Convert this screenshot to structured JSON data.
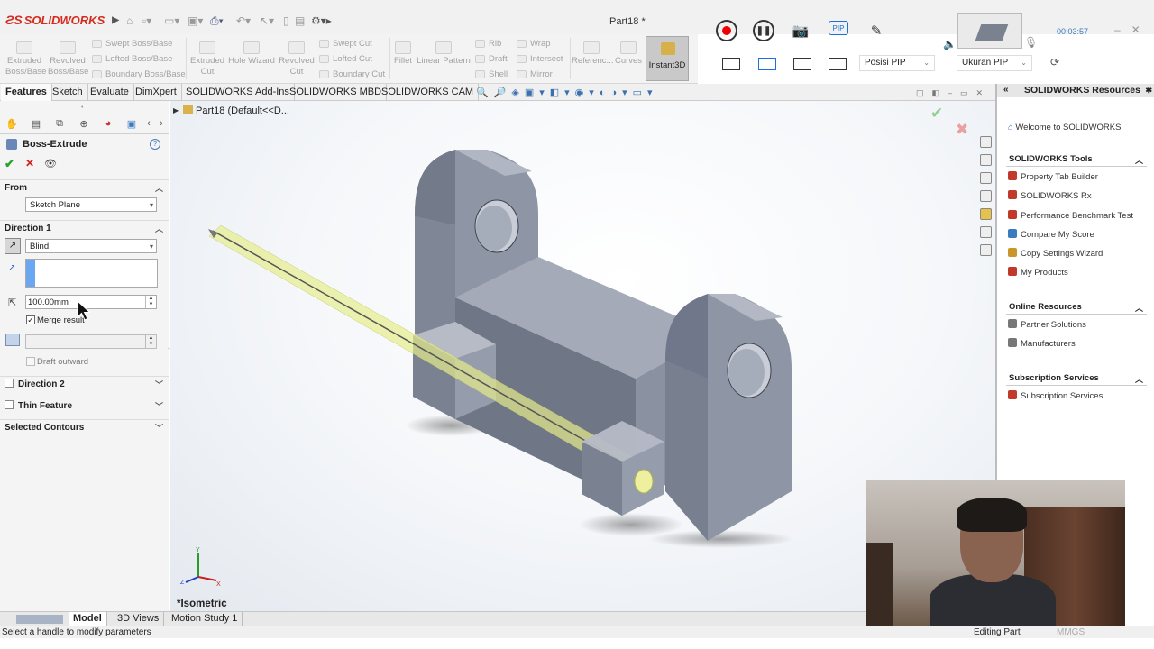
{
  "app": {
    "brand": "SOLIDWORKS",
    "doc_title": "Part18 *"
  },
  "recorder": {
    "timer": "00:03:57",
    "posisi_label": "Posisi PIP",
    "ukuran_label": "Ukuran PIP",
    "pip_label": "PIP"
  },
  "commands": {
    "extruded_boss": "Extruded Boss/Base",
    "revolved_boss": "Revolved Boss/Base",
    "swept_boss": "Swept Boss/Base",
    "lofted_boss": "Lofted Boss/Base",
    "boundary_boss": "Boundary Boss/Base",
    "extruded_cut": "Extruded Cut",
    "hole_wizard": "Hole Wizard",
    "revolved_cut": "Revolved Cut",
    "swept_cut": "Swept Cut",
    "lofted_cut": "Lofted Cut",
    "boundary_cut": "Boundary Cut",
    "fillet": "Fillet",
    "linear_pattern": "Linear Pattern",
    "rib": "Rib",
    "draft": "Draft",
    "shell": "Shell",
    "wrap": "Wrap",
    "intersect": "Intersect",
    "mirror": "Mirror",
    "reference": "Referenc...",
    "curves": "Curves",
    "instant3d": "Instant3D"
  },
  "tabs": [
    "Features",
    "Sketch",
    "Evaluate",
    "DimXpert",
    "SOLIDWORKS Add-Ins",
    "SOLIDWORKS MBD",
    "SOLIDWORKS CAM"
  ],
  "property_manager": {
    "title": "Boss-Extrude",
    "from_label": "From",
    "from_value": "Sketch Plane",
    "direction1_label": "Direction 1",
    "end_condition": "Blind",
    "depth": "100.00mm",
    "merge_result": "Merge result",
    "draft_outward": "Draft outward",
    "direction2_label": "Direction 2",
    "thin_feature_label": "Thin Feature",
    "selected_contours_label": "Selected Contours"
  },
  "viewport": {
    "tree_item": "Part18  (Default<<D...",
    "view_name": "*Isometric",
    "triad": {
      "x": "X",
      "y": "Y",
      "z": "Z"
    }
  },
  "bottom_tabs": [
    "Model",
    "3D Views",
    "Motion Study 1"
  ],
  "status": {
    "message": "Select a handle to modify parameters",
    "mode": "Editing Part",
    "units": "MMGS"
  },
  "task_pane": {
    "title": "SOLIDWORKS Resources",
    "welcome": "Welcome to SOLIDWORKS",
    "tools_header": "SOLIDWORKS Tools",
    "tools": [
      "Property Tab Builder",
      "SOLIDWORKS Rx",
      "Performance Benchmark Test",
      "Compare My Score",
      "Copy Settings Wizard",
      "My Products"
    ],
    "online_header": "Online Resources",
    "online": [
      "Partner Solutions",
      "Manufacturers"
    ],
    "subscription_header": "Subscription Services",
    "subscription": [
      "Subscription Services"
    ]
  },
  "colors": {
    "brand_red": "#d52b1e",
    "model_gray": "#8c93a3",
    "preview_yellow": "#e4ea8a"
  }
}
